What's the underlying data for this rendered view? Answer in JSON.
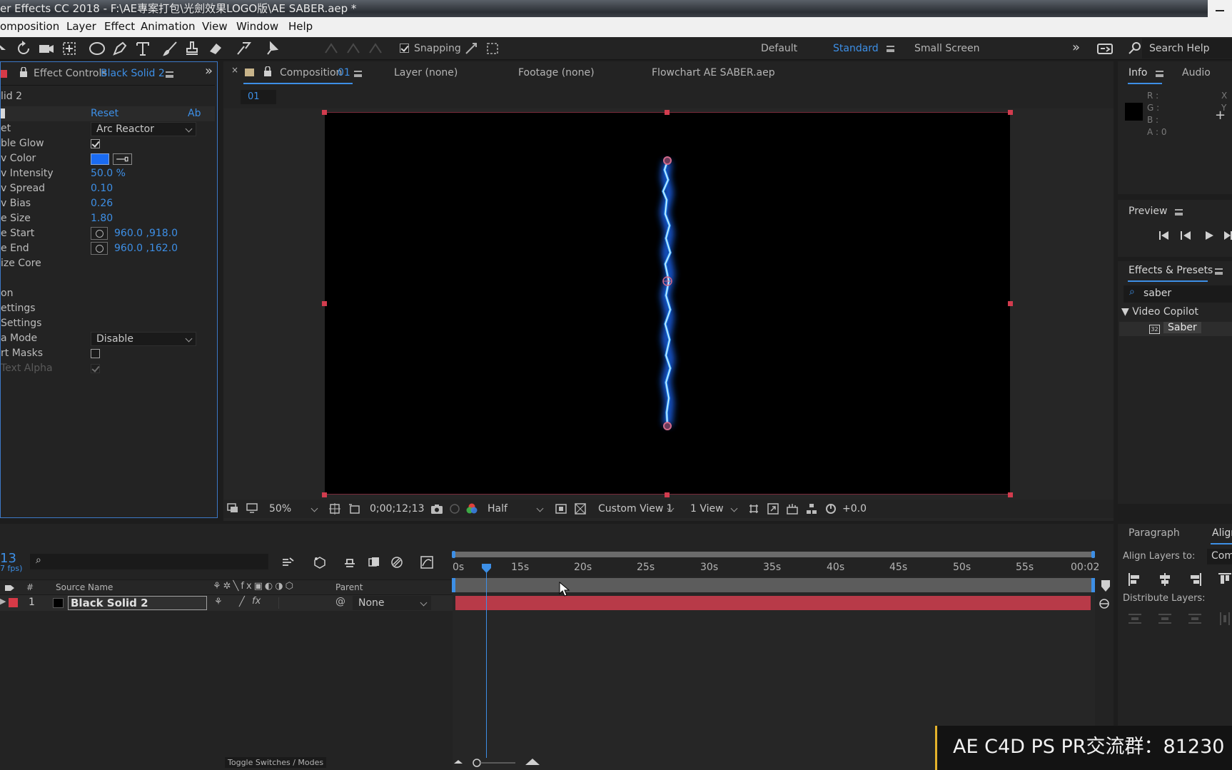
{
  "window": {
    "title": "er Effects CC 2018 - F:\\AE專案打包\\光劍效果LOGO版\\AE SABER.aep *"
  },
  "menu": {
    "items": [
      "omposition",
      "Layer",
      "Effect",
      "Animation",
      "View",
      "Window",
      "Help"
    ]
  },
  "toolbar": {
    "snapping_label": "Snapping",
    "workspaces": [
      "Default",
      "Standard",
      "Small Screen"
    ],
    "active_workspace": "Standard",
    "search_placeholder": "Search Help"
  },
  "effect_controls": {
    "tab_label": "Effect Controls",
    "tab_layer": "Black Solid 2",
    "layer_row": "lid 2",
    "reset_label": "Reset",
    "about_label": "Ab",
    "rows": [
      {
        "label": "et",
        "value": "Arc Reactor"
      },
      {
        "label": "ble Glow",
        "value": ""
      },
      {
        "label": "v Color",
        "value": ""
      },
      {
        "label": "v Intensity",
        "value": "50.0 %"
      },
      {
        "label": "v Spread",
        "value": "0.10"
      },
      {
        "label": "v Bias",
        "value": "0.26"
      },
      {
        "label": "e Size",
        "value": "1.80"
      },
      {
        "label": "e Start",
        "value": "960.0 ,918.0"
      },
      {
        "label": "e End",
        "value": "960.0 ,162.0"
      },
      {
        "label": "ize Core",
        "value": ""
      },
      {
        "label": "",
        "value": ""
      },
      {
        "label": "on",
        "value": ""
      },
      {
        "label": "ettings",
        "value": ""
      },
      {
        "label": "Settings",
        "value": ""
      },
      {
        "label": "a Mode",
        "value": "Disable"
      },
      {
        "label": "rt Masks",
        "value": ""
      },
      {
        "label": "Text Alpha",
        "value": ""
      }
    ],
    "glow_color": "#1a6bf2"
  },
  "composition": {
    "tab_label": "Composition",
    "tab_name": "01",
    "sub_tab": "01",
    "other_tabs": [
      "Layer  (none)",
      "Footage  (none)",
      "Flowchart  AE SABER.aep"
    ],
    "saber_color": "#39a8ff"
  },
  "viewer_bar": {
    "zoom": "50%",
    "timecode": "0;00;12;13",
    "resolution": "Half",
    "view": "Custom View 1",
    "layout": "1 View",
    "exposure": "+0.0"
  },
  "info_panel": {
    "tabs": [
      "Info",
      "Audio"
    ],
    "channels": [
      "R :",
      "G :",
      "B :",
      "A : 0"
    ],
    "side_labels": [
      "X",
      "Y"
    ]
  },
  "preview_panel": {
    "title": "Preview"
  },
  "effects_presets": {
    "title": "Effects & Presets",
    "search_value": "saber",
    "category": "▼ Video Copilot",
    "item": "Saber"
  },
  "paragraph_align": {
    "tabs": [
      "Paragraph",
      "Align"
    ],
    "align_layers_label": "Align Layers to:",
    "align_target": "Comp",
    "distribute_label": "Distribute Layers:"
  },
  "timeline": {
    "current_time": "13",
    "fps": "7 fps)",
    "columns": {
      "number": "#",
      "source_name": "Source Name",
      "parent": "Parent"
    },
    "layers": [
      {
        "index": "1",
        "name": "Black Solid 2",
        "parent": "None",
        "label_color": "#d63a47"
      }
    ],
    "ruler_ticks": [
      "0s",
      "15s",
      "20s",
      "25s",
      "30s",
      "35s",
      "40s",
      "45s",
      "50s",
      "55s",
      "00:02"
    ],
    "toggle_label": "Toggle Switches / Modes",
    "bar_color": "#b83a48"
  },
  "watermark": {
    "text": "AE C4D PS PR交流群：81230"
  }
}
